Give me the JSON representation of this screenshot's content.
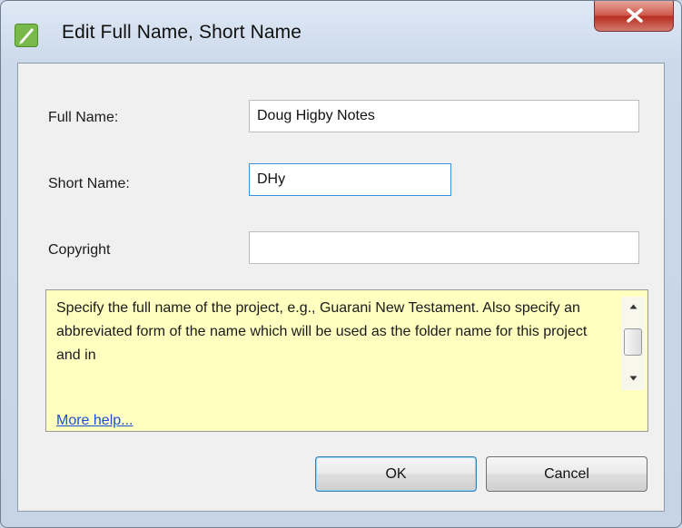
{
  "window": {
    "title": "Edit Full Name, Short Name",
    "icon": "green-pen-icon",
    "close_icon": "close-icon"
  },
  "form": {
    "full_name_label": "Full Name:",
    "full_name_value": "Doug Higby Notes",
    "short_name_label": "Short Name:",
    "short_name_value": "DHy",
    "copyright_label": "Copyright",
    "copyright_value": ""
  },
  "help": {
    "text": "Specify the full name of the project, e.g., Guarani New Testament. Also specify an abbreviated form of the name which will be used as the folder name for this project and in",
    "more_help": "More help..."
  },
  "buttons": {
    "ok": "OK",
    "cancel": "Cancel"
  },
  "colors": {
    "help_background": "#ffffc0",
    "link": "#1e4fd6",
    "close_button": "#c8392f",
    "focus_border": "#3d8fe0"
  }
}
